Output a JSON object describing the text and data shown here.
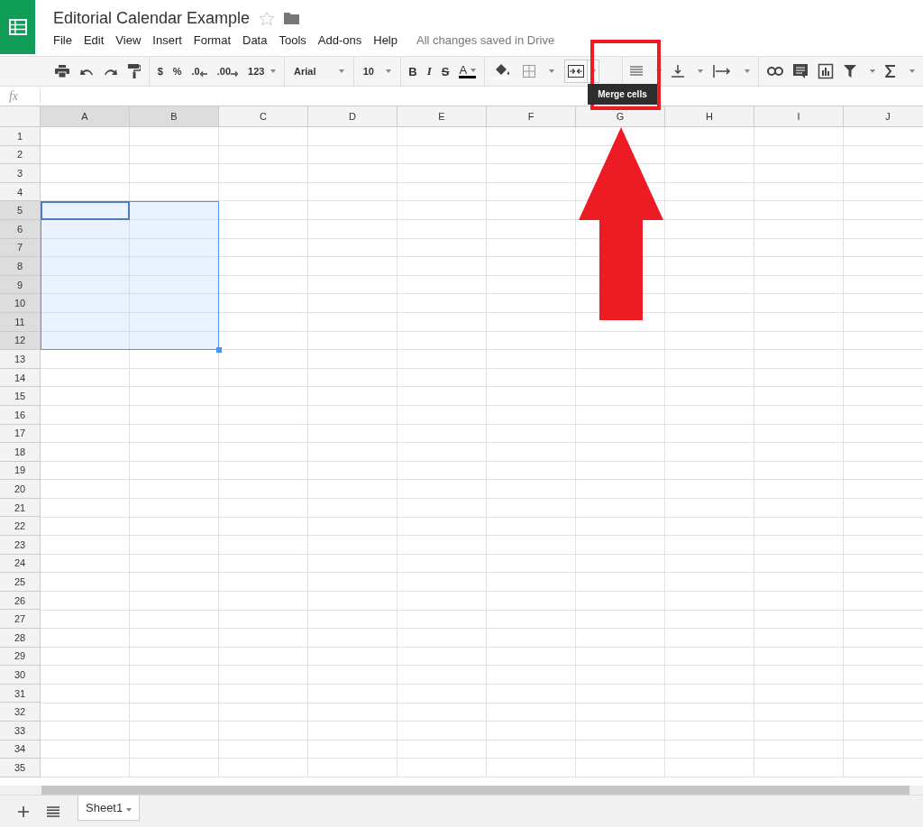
{
  "document": {
    "title": "Editorial Calendar Example",
    "starred": false,
    "save_status": "All changes saved in Drive"
  },
  "menu": [
    "File",
    "Edit",
    "View",
    "Insert",
    "Format",
    "Data",
    "Tools",
    "Add-ons",
    "Help"
  ],
  "toolbar": {
    "currency": "$",
    "percent": "%",
    "decrease_decimals": ".0",
    "increase_decimals": ".00",
    "more_formats": "123",
    "font": "Arial",
    "font_size": "10",
    "bold": "B",
    "italic": "I",
    "strikethrough": "S",
    "text_color": "A",
    "merge_hovered": true
  },
  "tooltip": "Merge cells",
  "formula_bar": {
    "label": "fx"
  },
  "columns": [
    {
      "label": "A",
      "selected": true
    },
    {
      "label": "B",
      "selected": true
    },
    {
      "label": "C",
      "selected": false
    },
    {
      "label": "D",
      "selected": false
    },
    {
      "label": "E",
      "selected": false
    },
    {
      "label": "F",
      "selected": false
    },
    {
      "label": "G",
      "selected": false
    },
    {
      "label": "H",
      "selected": false
    },
    {
      "label": "I",
      "selected": false
    },
    {
      "label": "J",
      "selected": false
    }
  ],
  "rows": [
    {
      "label": "1",
      "selected": false
    },
    {
      "label": "2",
      "selected": false
    },
    {
      "label": "3",
      "selected": false
    },
    {
      "label": "4",
      "selected": false
    },
    {
      "label": "5",
      "selected": true
    },
    {
      "label": "6",
      "selected": true
    },
    {
      "label": "7",
      "selected": true
    },
    {
      "label": "8",
      "selected": true
    },
    {
      "label": "9",
      "selected": true
    },
    {
      "label": "10",
      "selected": true
    },
    {
      "label": "11",
      "selected": true
    },
    {
      "label": "12",
      "selected": true
    },
    {
      "label": "13",
      "selected": false
    },
    {
      "label": "14",
      "selected": false
    },
    {
      "label": "15",
      "selected": false
    },
    {
      "label": "16",
      "selected": false
    },
    {
      "label": "17",
      "selected": false
    },
    {
      "label": "18",
      "selected": false
    },
    {
      "label": "19",
      "selected": false
    },
    {
      "label": "20",
      "selected": false
    },
    {
      "label": "21",
      "selected": false
    },
    {
      "label": "22",
      "selected": false
    },
    {
      "label": "23",
      "selected": false
    },
    {
      "label": "24",
      "selected": false
    },
    {
      "label": "25",
      "selected": false
    },
    {
      "label": "26",
      "selected": false
    },
    {
      "label": "27",
      "selected": false
    },
    {
      "label": "28",
      "selected": false
    },
    {
      "label": "29",
      "selected": false
    },
    {
      "label": "30",
      "selected": false
    },
    {
      "label": "31",
      "selected": false
    },
    {
      "label": "32",
      "selected": false
    },
    {
      "label": "33",
      "selected": false
    },
    {
      "label": "34",
      "selected": false
    },
    {
      "label": "35",
      "selected": false
    }
  ],
  "sheets": [
    {
      "label": "Sheet1",
      "selected": true
    }
  ]
}
